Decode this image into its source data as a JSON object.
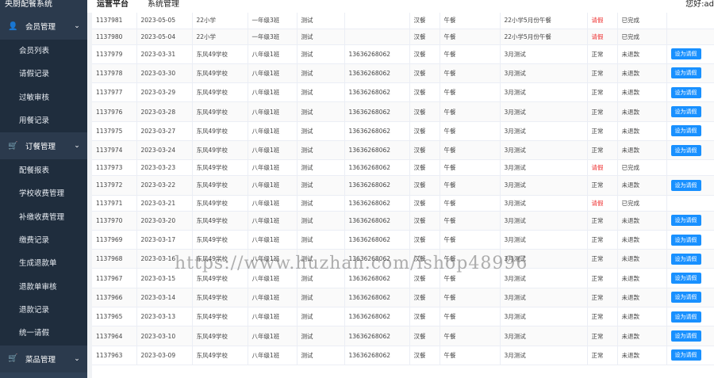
{
  "app": {
    "title": "央厨配餐系统"
  },
  "sidebar": {
    "groups": [
      {
        "label": "会员管理",
        "items": [
          "会员列表",
          "请假记录",
          "过敏审核",
          "用餐记录"
        ]
      },
      {
        "label": "订餐管理",
        "items": [
          "配餐报表",
          "学校收费管理",
          "补缴收费管理",
          "缴费记录",
          "生成退款单",
          "退款单审核",
          "退款记录",
          "统一请假"
        ]
      },
      {
        "label": "菜品管理",
        "items": []
      }
    ]
  },
  "header": {
    "tabs": [
      "运营平台",
      "系统管理"
    ],
    "greeting": "您好:ad"
  },
  "table": {
    "rows": [
      {
        "id": "1137981",
        "date": "2023-05-05",
        "school": "22小学",
        "class": "一年级3班",
        "name": "测试",
        "phone": "",
        "meal": "汉餐",
        "time": "午餐",
        "desc": "22小学5月份午餐",
        "status": "请假",
        "refund": "已完成",
        "action": ""
      },
      {
        "id": "1137980",
        "date": "2023-05-04",
        "school": "22小学",
        "class": "一年级3班",
        "name": "测试",
        "phone": "",
        "meal": "汉餐",
        "time": "午餐",
        "desc": "22小学5月份午餐",
        "status": "请假",
        "refund": "已完成",
        "action": ""
      },
      {
        "id": "1137979",
        "date": "2023-03-31",
        "school": "东风49学校",
        "class": "八年级1班",
        "name": "测试",
        "phone": "13636268062",
        "meal": "汉餐",
        "time": "午餐",
        "desc": "3月测试",
        "status": "正常",
        "refund": "未退款",
        "action": "设为请假"
      },
      {
        "id": "1137978",
        "date": "2023-03-30",
        "school": "东风49学校",
        "class": "八年级1班",
        "name": "测试",
        "phone": "13636268062",
        "meal": "汉餐",
        "time": "午餐",
        "desc": "3月测试",
        "status": "正常",
        "refund": "未退款",
        "action": "设为请假"
      },
      {
        "id": "1137977",
        "date": "2023-03-29",
        "school": "东风49学校",
        "class": "八年级1班",
        "name": "测试",
        "phone": "13636268062",
        "meal": "汉餐",
        "time": "午餐",
        "desc": "3月测试",
        "status": "正常",
        "refund": "未退款",
        "action": "设为请假"
      },
      {
        "id": "1137976",
        "date": "2023-03-28",
        "school": "东风49学校",
        "class": "八年级1班",
        "name": "测试",
        "phone": "13636268062",
        "meal": "汉餐",
        "time": "午餐",
        "desc": "3月测试",
        "status": "正常",
        "refund": "未退款",
        "action": "设为请假"
      },
      {
        "id": "1137975",
        "date": "2023-03-27",
        "school": "东风49学校",
        "class": "八年级1班",
        "name": "测试",
        "phone": "13636268062",
        "meal": "汉餐",
        "time": "午餐",
        "desc": "3月测试",
        "status": "正常",
        "refund": "未退款",
        "action": "设为请假"
      },
      {
        "id": "1137974",
        "date": "2023-03-24",
        "school": "东风49学校",
        "class": "八年级1班",
        "name": "测试",
        "phone": "13636268062",
        "meal": "汉餐",
        "time": "午餐",
        "desc": "3月测试",
        "status": "正常",
        "refund": "未退款",
        "action": "设为请假"
      },
      {
        "id": "1137973",
        "date": "2023-03-23",
        "school": "东风49学校",
        "class": "八年级1班",
        "name": "测试",
        "phone": "13636268062",
        "meal": "汉餐",
        "time": "午餐",
        "desc": "3月测试",
        "status": "请假",
        "refund": "已完成",
        "action": ""
      },
      {
        "id": "1137972",
        "date": "2023-03-22",
        "school": "东风49学校",
        "class": "八年级1班",
        "name": "测试",
        "phone": "13636268062",
        "meal": "汉餐",
        "time": "午餐",
        "desc": "3月测试",
        "status": "正常",
        "refund": "未退款",
        "action": "设为请假"
      },
      {
        "id": "1137971",
        "date": "2023-03-21",
        "school": "东风49学校",
        "class": "八年级1班",
        "name": "测试",
        "phone": "13636268062",
        "meal": "汉餐",
        "time": "午餐",
        "desc": "3月测试",
        "status": "请假",
        "refund": "已完成",
        "action": ""
      },
      {
        "id": "1137970",
        "date": "2023-03-20",
        "school": "东风49学校",
        "class": "八年级1班",
        "name": "测试",
        "phone": "13636268062",
        "meal": "汉餐",
        "time": "午餐",
        "desc": "3月测试",
        "status": "正常",
        "refund": "未退款",
        "action": "设为请假"
      },
      {
        "id": "1137969",
        "date": "2023-03-17",
        "school": "东风49学校",
        "class": "八年级1班",
        "name": "测试",
        "phone": "13636268062",
        "meal": "汉餐",
        "time": "午餐",
        "desc": "3月测试",
        "status": "正常",
        "refund": "未退款",
        "action": "设为请假"
      },
      {
        "id": "1137968",
        "date": "2023-03-16",
        "school": "东风49学校",
        "class": "八年级1班",
        "name": "测试",
        "phone": "13636268062",
        "meal": "汉餐",
        "time": "午餐",
        "desc": "3月测试",
        "status": "正常",
        "refund": "未退款",
        "action": "设为请假"
      },
      {
        "id": "1137967",
        "date": "2023-03-15",
        "school": "东风49学校",
        "class": "八年级1班",
        "name": "测试",
        "phone": "13636268062",
        "meal": "汉餐",
        "time": "午餐",
        "desc": "3月测试",
        "status": "正常",
        "refund": "未退款",
        "action": "设为请假"
      },
      {
        "id": "1137966",
        "date": "2023-03-14",
        "school": "东风49学校",
        "class": "八年级1班",
        "name": "测试",
        "phone": "13636268062",
        "meal": "汉餐",
        "time": "午餐",
        "desc": "3月测试",
        "status": "正常",
        "refund": "未退款",
        "action": "设为请假"
      },
      {
        "id": "1137965",
        "date": "2023-03-13",
        "school": "东风49学校",
        "class": "八年级1班",
        "name": "测试",
        "phone": "13636268062",
        "meal": "汉餐",
        "time": "午餐",
        "desc": "3月测试",
        "status": "正常",
        "refund": "未退款",
        "action": "设为请假"
      },
      {
        "id": "1137964",
        "date": "2023-03-10",
        "school": "东风49学校",
        "class": "八年级1班",
        "name": "测试",
        "phone": "13636268062",
        "meal": "汉餐",
        "time": "午餐",
        "desc": "3月测试",
        "status": "正常",
        "refund": "未退款",
        "action": "设为请假"
      },
      {
        "id": "1137963",
        "date": "2023-03-09",
        "school": "东风49学校",
        "class": "八年级1班",
        "name": "测试",
        "phone": "13636268062",
        "meal": "汉餐",
        "time": "午餐",
        "desc": "3月测试",
        "status": "正常",
        "refund": "未退款",
        "action": "设为请假"
      }
    ]
  },
  "watermark": "https://www.huzhan.com/ishop48996",
  "colors": {
    "sidebar": "#304156",
    "accent": "#1890ff",
    "leave": "#e33"
  }
}
